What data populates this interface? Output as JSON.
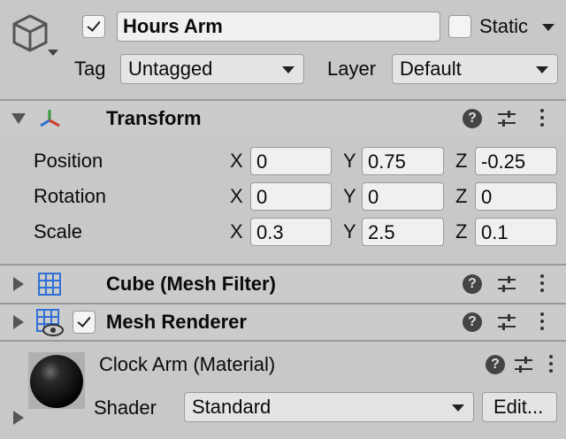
{
  "object": {
    "name": "Hours Arm",
    "active_checked": true,
    "static_label": "Static",
    "static_checked": false,
    "tag_label": "Tag",
    "tag_value": "Untagged",
    "layer_label": "Layer",
    "layer_value": "Default"
  },
  "transform": {
    "title": "Transform",
    "rows": [
      {
        "label": "Position",
        "x_axis": "X",
        "x": "0",
        "y_axis": "Y",
        "y": "0.75",
        "z_axis": "Z",
        "z": "-0.25"
      },
      {
        "label": "Rotation",
        "x_axis": "X",
        "x": "0",
        "y_axis": "Y",
        "y": "0",
        "z_axis": "Z",
        "z": "0"
      },
      {
        "label": "Scale",
        "x_axis": "X",
        "x": "0.3",
        "y_axis": "Y",
        "y": "2.5",
        "z_axis": "Z",
        "z": "0.1"
      }
    ]
  },
  "mesh_filter": {
    "title": "Cube (Mesh Filter)"
  },
  "mesh_renderer": {
    "title": "Mesh Renderer",
    "enabled": true
  },
  "material": {
    "title": "Clock Arm (Material)",
    "shader_label": "Shader",
    "shader_value": "Standard",
    "edit_label": "Edit..."
  },
  "icons": {
    "help": "?",
    "colors": {
      "accent_blue": "#2f6fd6",
      "axis_red": "#d23b2b",
      "axis_green": "#3a9a3a"
    }
  }
}
